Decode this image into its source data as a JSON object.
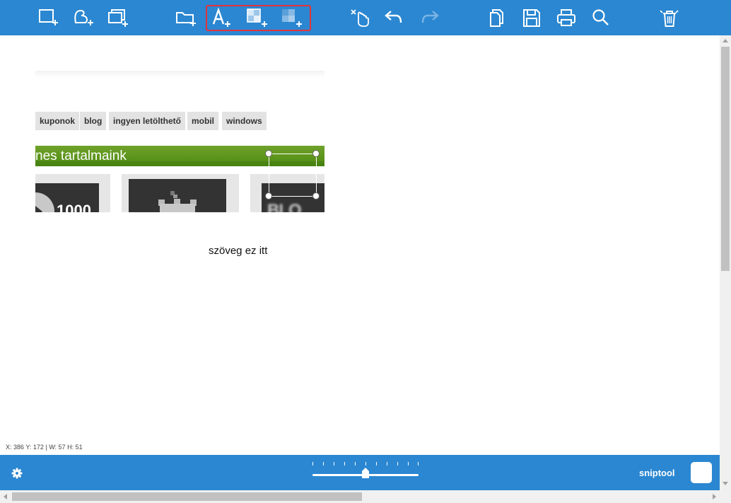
{
  "toolbar": {
    "background": "#2b87d1",
    "highlight_color": "#e0333d",
    "buttons": [
      {
        "name": "rectangle-snip-icon"
      },
      {
        "name": "freeform-snip-icon"
      },
      {
        "name": "window-snip-icon"
      },
      {
        "name": "open-folder-icon"
      },
      {
        "name": "add-text-icon"
      },
      {
        "name": "add-pixelate-icon"
      },
      {
        "name": "add-blur-icon"
      },
      {
        "name": "select-pointer-icon"
      },
      {
        "name": "undo-icon"
      },
      {
        "name": "redo-icon"
      },
      {
        "name": "copy-icon"
      },
      {
        "name": "save-icon"
      },
      {
        "name": "print-icon"
      },
      {
        "name": "zoom-icon"
      },
      {
        "name": "delete-icon"
      }
    ]
  },
  "snip": {
    "tags": [
      "kuponok",
      "blog",
      "ingyen letölthető",
      "mobil",
      "windows"
    ],
    "section_title": "nes tartalmaink",
    "tile1_text": "1000",
    "tile3_text": "BLO"
  },
  "canvas": {
    "annotation_text": "szöveg ez itt",
    "coords": "X: 386 Y: 172   |   W: 57 H: 51"
  },
  "bottombar": {
    "brand": "sniptool",
    "zoom_fraction": 0.5
  }
}
